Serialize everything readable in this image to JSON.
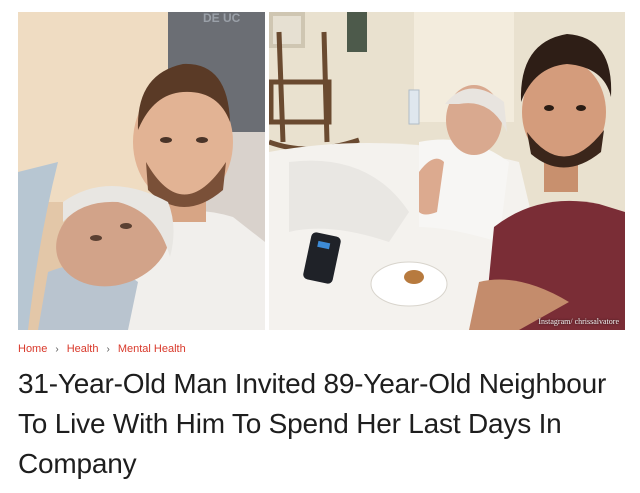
{
  "photos": [
    {
      "name": "selfie-with-elderly-neighbour-left",
      "alt": ""
    },
    {
      "name": "selfie-with-elderly-neighbour-in-bed-right",
      "alt": ""
    }
  ],
  "photo_credit": "Instagram/ chrissalvatore",
  "breadcrumb": {
    "items": [
      "Home",
      "Health",
      "Mental Health"
    ],
    "separator_icon": "chevron-right-icon"
  },
  "headline": "31-Year-Old Man Invited 89-Year-Old Neighbour To Live With Him To Spend Her Last Days In Company",
  "colors": {
    "breadcrumb_accent": "#d9392b",
    "headline_text": "#1e1e1e",
    "background": "#ffffff"
  }
}
